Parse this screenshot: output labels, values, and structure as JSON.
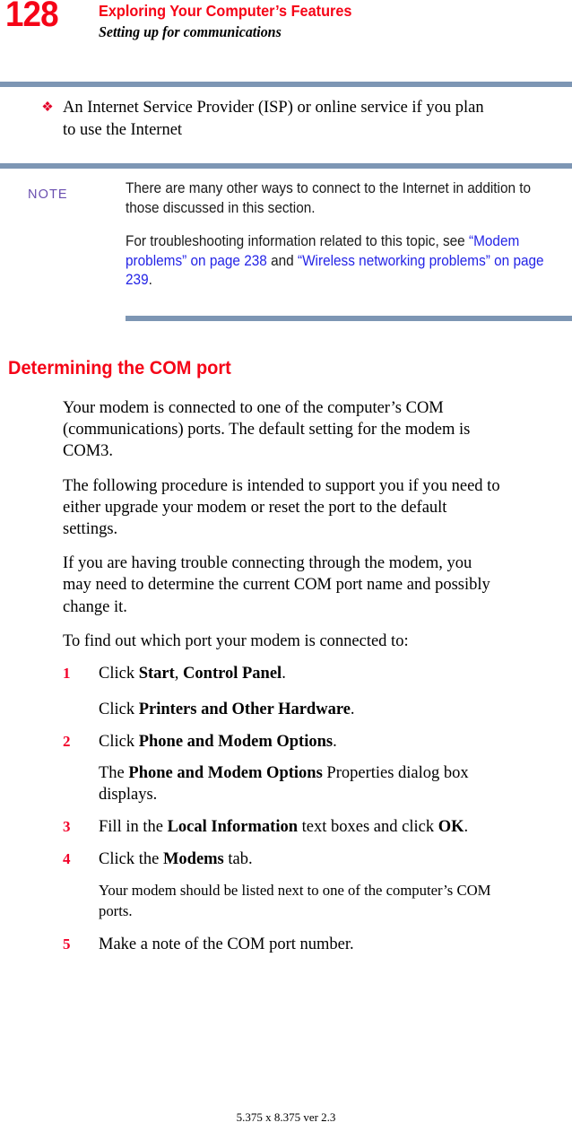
{
  "header": {
    "page_number": "128",
    "chapter_title": "Exploring Your Computer’s Features",
    "section_title": "Setting up for communications",
    "chapter_color": "#f50417",
    "rule_color": "#7d96b4"
  },
  "bullet": {
    "glyph": "diamond-bullet-icon",
    "glyph_char": "❖",
    "text": "An Internet Service Provider (ISP) or online service if you plan to use the Internet"
  },
  "note": {
    "label": "NOTE",
    "label_color": "#6a4fb0",
    "paragraph_1": "There are many other ways to connect to the Internet in addition to those discussed in this section.",
    "paragraph_2_prefix": "For troubleshooting information related to this topic, see ",
    "xref_1": "“Modem problems” on page 238",
    "paragraph_2_mid": " and ",
    "xref_2": "“Wireless networking problems” on page 239",
    "paragraph_2_suffix": ".",
    "xref_color": "#2424e6"
  },
  "section": {
    "heading": "Determining the COM port",
    "heading_color": "#f50417",
    "paragraphs": [
      "Your modem is connected to one of the computer’s COM (communications) ports. The default setting for the modem is COM3.",
      "The following procedure is intended to support you if you need to either upgrade your modem or reset the port to the default settings.",
      "If you are having trouble connecting through the modem, you may need to determine the current COM port name and possibly change it.",
      "To find out which port your modem is connected to:"
    ]
  },
  "steps": [
    {
      "number": "1",
      "pre": "Click ",
      "bold_1": "Start",
      "mid": ", ",
      "bold_2": "Control Panel",
      "post": ".",
      "substeps": [
        {
          "pre": "Click ",
          "bold_1": "Printers and Other Hardware",
          "post": "."
        }
      ]
    },
    {
      "number": "2",
      "pre": "Click ",
      "bold_1": "Phone and Modem Options",
      "post": ".",
      "substeps": [
        {
          "pre": "The ",
          "bold_1": "Phone and Modem Options",
          "post": " Properties dialog box displays."
        }
      ]
    },
    {
      "number": "3",
      "pre": "Fill in the ",
      "bold_1": "Local Information",
      "mid": " text boxes and click ",
      "bold_2": "OK",
      "post": ".",
      "substeps": []
    },
    {
      "number": "4",
      "pre": "Click the ",
      "bold_1": "Modems",
      "post": " tab.",
      "substeps": [
        {
          "plain": "Your modem should be listed next to one of the computer’s COM ports."
        }
      ]
    },
    {
      "number": "5",
      "plain": "Make a note of the COM port number.",
      "substeps": []
    }
  ],
  "footer": {
    "text": "5.375 x 8.375 ver 2.3"
  }
}
